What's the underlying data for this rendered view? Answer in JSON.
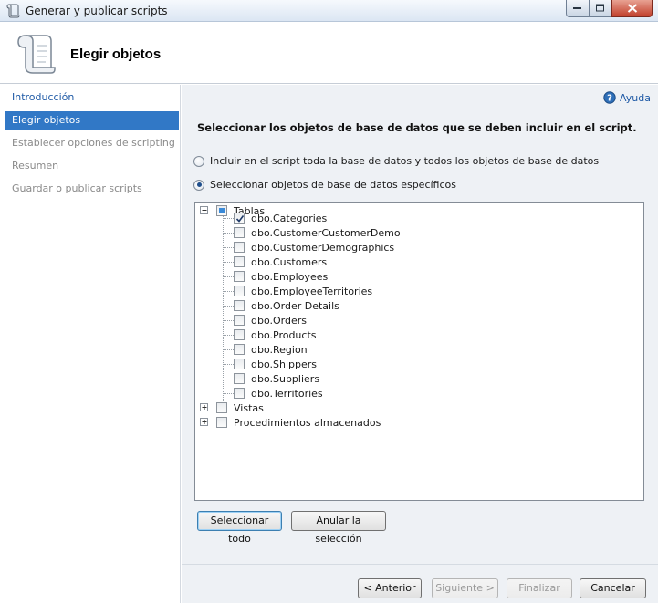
{
  "window": {
    "title": "Generar y publicar scripts"
  },
  "header": {
    "page_title": "Elegir objetos"
  },
  "nav": {
    "items": [
      {
        "label": "Introducción",
        "state": "link"
      },
      {
        "label": "Elegir objetos",
        "state": "selected"
      },
      {
        "label": "Establecer opciones de scripting",
        "state": "disabled"
      },
      {
        "label": "Resumen",
        "state": "disabled"
      },
      {
        "label": "Guardar o publicar scripts",
        "state": "disabled"
      }
    ]
  },
  "help": {
    "label": "Ayuda"
  },
  "main": {
    "section_title": "Seleccionar los objetos de base de datos que se deben incluir en el script.",
    "options": [
      {
        "label": "Incluir en el script toda la base de datos y todos los objetos de base de datos",
        "selected": false
      },
      {
        "label": "Seleccionar objetos de base de datos específicos",
        "selected": true
      }
    ],
    "tree": {
      "tables": {
        "label": "Tablas",
        "expanded": true,
        "state": "partial",
        "items": [
          {
            "label": "dbo.Categories",
            "checked": true
          },
          {
            "label": "dbo.CustomerCustomerDemo",
            "checked": false
          },
          {
            "label": "dbo.CustomerDemographics",
            "checked": false
          },
          {
            "label": "dbo.Customers",
            "checked": false
          },
          {
            "label": "dbo.Employees",
            "checked": false
          },
          {
            "label": "dbo.EmployeeTerritories",
            "checked": false
          },
          {
            "label": "dbo.Order Details",
            "checked": false
          },
          {
            "label": "dbo.Orders",
            "checked": false
          },
          {
            "label": "dbo.Products",
            "checked": false
          },
          {
            "label": "dbo.Region",
            "checked": false
          },
          {
            "label": "dbo.Shippers",
            "checked": false
          },
          {
            "label": "dbo.Suppliers",
            "checked": false
          },
          {
            "label": "dbo.Territories",
            "checked": false
          }
        ]
      },
      "views": {
        "label": "Vistas",
        "expanded": false,
        "checked": false
      },
      "procedures": {
        "label": "Procedimientos almacenados",
        "expanded": false,
        "checked": false
      }
    },
    "select_all_label": "Seleccionar todo",
    "clear_selection_label": "Anular la selección"
  },
  "footer": {
    "previous_label": "< Anterior",
    "next_label": "Siguiente >",
    "finish_label": "Finalizar",
    "cancel_label": "Cancelar"
  },
  "colors": {
    "selected_nav": "#3178c6",
    "link": "#1f5aa6",
    "content_bg": "#eef1f5"
  }
}
